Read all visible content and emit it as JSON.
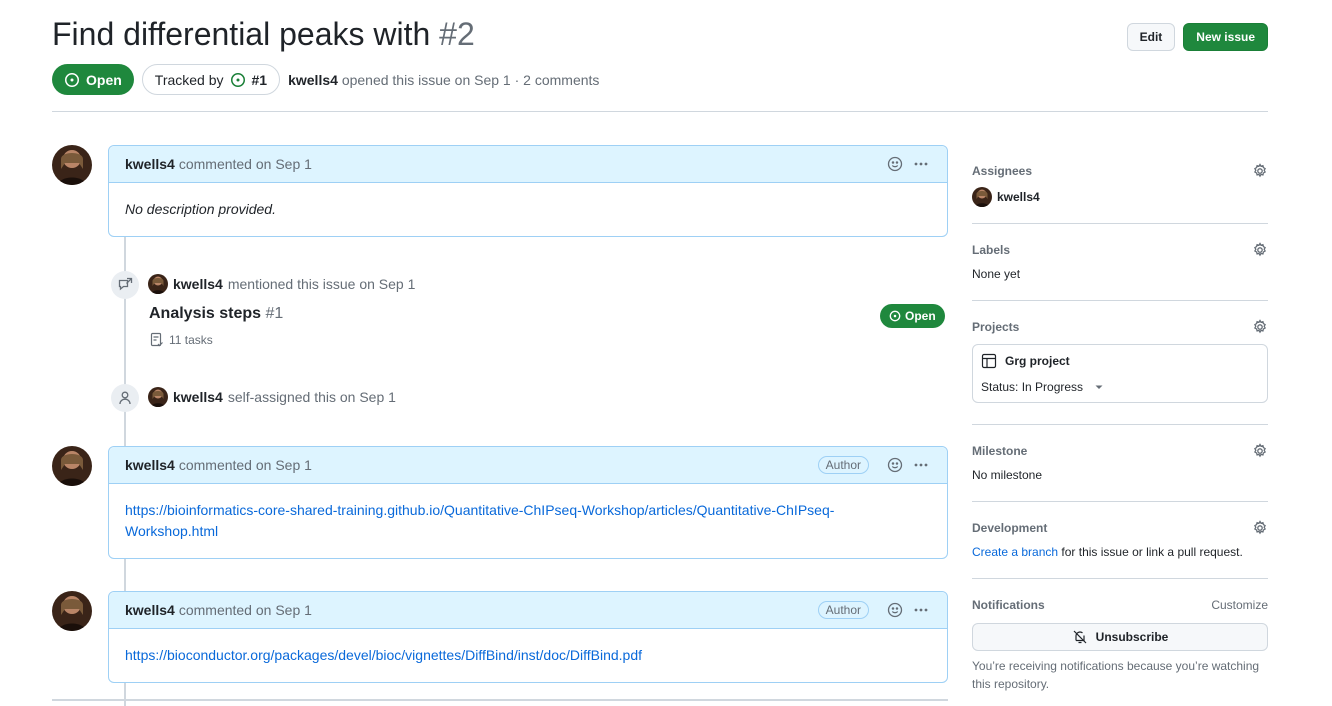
{
  "issue": {
    "title": "Find differential peaks with",
    "number": "#2",
    "state": "Open",
    "tracked_by_label": "Tracked by",
    "tracked_by_number": "#1",
    "author": "kwells4",
    "opened_text": "opened this issue on Sep 1 · 2 comments"
  },
  "header_buttons": {
    "edit": "Edit",
    "new_issue": "New issue"
  },
  "timeline": {
    "comment1": {
      "author": "kwells4",
      "action": "commented on Sep 1",
      "body": "No description provided."
    },
    "mention": {
      "author": "kwells4",
      "text": "mentioned this issue on Sep 1",
      "ref_title": "Analysis steps",
      "ref_number": "#1",
      "ref_tasks": "11 tasks",
      "ref_state": "Open"
    },
    "assign": {
      "author": "kwells4",
      "text": "self-assigned this on Sep 1"
    },
    "comment2": {
      "author": "kwells4",
      "action": "commented on Sep 1",
      "badge": "Author",
      "link_line1": "https://bioinformatics-core-shared-training.github.io/Quantitative-ChIPseq-Workshop/articles/Quantitative-ChIPseq-",
      "link_line2": "Workshop.html"
    },
    "comment3": {
      "author": "kwells4",
      "action": "commented on Sep 1",
      "badge": "Author",
      "link": "https://bioconductor.org/packages/devel/bioc/vignettes/DiffBind/inst/doc/DiffBind.pdf"
    }
  },
  "sidebar": {
    "assignees": {
      "heading": "Assignees",
      "value": "kwells4"
    },
    "labels": {
      "heading": "Labels",
      "value": "None yet"
    },
    "projects": {
      "heading": "Projects",
      "project_name": "Grg project",
      "status": "Status: In Progress"
    },
    "milestone": {
      "heading": "Milestone",
      "value": "No milestone"
    },
    "development": {
      "heading": "Development",
      "link": "Create a branch",
      "text": " for this issue or link a pull request."
    },
    "notifications": {
      "heading": "Notifications",
      "customize": "Customize",
      "button": "Unsubscribe",
      "text": "You’re receiving notifications because you’re watching this repository."
    }
  },
  "colors": {
    "accent": "#1f883d",
    "link": "#0969da",
    "comment_header": "#ddf4ff",
    "comment_border": "#9ed0f5"
  },
  "icons": [
    "issue-opened-icon",
    "smiley-icon",
    "kebab-icon",
    "cross-reference-icon",
    "person-icon",
    "checklist-icon",
    "gear-icon",
    "table-icon",
    "triangle-down-icon",
    "bell-slash-icon"
  ]
}
